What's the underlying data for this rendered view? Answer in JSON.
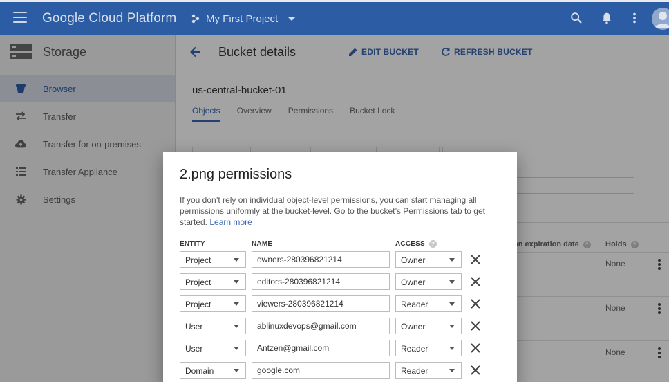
{
  "topbar": {
    "brand": "Google Cloud Platform",
    "project": "My First Project",
    "icons": [
      "menu-icon",
      "project-icon",
      "chevron-down-icon",
      "search-icon",
      "bell-icon",
      "more-vert-icon",
      "avatar"
    ]
  },
  "sidebar": {
    "title": "Storage",
    "items": [
      {
        "label": "Browser",
        "icon": "bucket-icon",
        "active": true
      },
      {
        "label": "Transfer",
        "icon": "transfer-icon",
        "active": false
      },
      {
        "label": "Transfer for on-premises",
        "icon": "cloud-upload-icon",
        "active": false
      },
      {
        "label": "Transfer Appliance",
        "icon": "list-icon",
        "active": false
      },
      {
        "label": "Settings",
        "icon": "gear-icon",
        "active": false
      }
    ]
  },
  "main": {
    "title": "Bucket details",
    "edit_label": "EDIT BUCKET",
    "refresh_label": "REFRESH BUCKET",
    "bucket_name": "us-central-bucket-01",
    "tabs": [
      {
        "label": "Objects",
        "active": true
      },
      {
        "label": "Overview",
        "active": false
      },
      {
        "label": "Permissions",
        "active": false
      },
      {
        "label": "Bucket Lock",
        "active": false
      }
    ],
    "col_retention": "on expiration date",
    "col_holds": "Holds",
    "rows": [
      {
        "holds": "None"
      },
      {
        "holds": "None"
      },
      {
        "holds": "None"
      }
    ]
  },
  "dialog": {
    "title": "2.png permissions",
    "description": "If you don’t rely on individual object-level permissions, you can start managing all permissions uniformly at the bucket-level. Go to the bucket’s Permissions tab to get started.",
    "learn_more": "Learn more",
    "headers": {
      "entity": "ENTITY",
      "name": "NAME",
      "access": "ACCESS"
    },
    "permissions": [
      {
        "entity": "Project",
        "name": "owners-280396821214",
        "access": "Owner"
      },
      {
        "entity": "Project",
        "name": "editors-280396821214",
        "access": "Owner"
      },
      {
        "entity": "Project",
        "name": "viewers-280396821214",
        "access": "Reader"
      },
      {
        "entity": "User",
        "name": "ablinuxdevops@gmail.com",
        "access": "Owner"
      },
      {
        "entity": "User",
        "name": "Antzen@gmail.com",
        "access": "Reader"
      },
      {
        "entity": "Domain",
        "name": "google.com",
        "access": "Reader"
      }
    ]
  },
  "colors": {
    "topbar": "#2c5ca3",
    "accent": "#3a67b3",
    "sidebar_bg": "#f1f1f1",
    "active_item_bg": "#d9dfe9"
  }
}
